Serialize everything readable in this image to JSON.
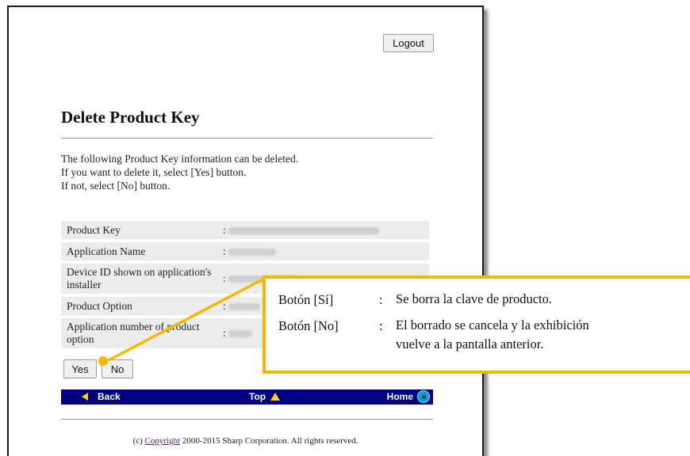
{
  "header": {
    "logout_label": "Logout"
  },
  "page": {
    "title": "Delete Product Key",
    "intro_lines": [
      "The following Product Key information can be deleted.",
      "If you want to delete it, select [Yes] button.",
      "If not, select [No] button."
    ]
  },
  "info_table": {
    "rows": [
      {
        "label": "Product Key",
        "value_sep": ":"
      },
      {
        "label": "Application Name",
        "value_sep": ":"
      },
      {
        "label": "Device ID shown on application's installer",
        "value_sep": ":"
      },
      {
        "label": "Product Option",
        "value_sep": ":"
      },
      {
        "label": "Application number of product option",
        "value_sep": ":"
      }
    ]
  },
  "actions": {
    "yes_label": "Yes",
    "no_label": "No"
  },
  "nav": {
    "back_label": "Back",
    "top_label": "Top",
    "home_label": "Home"
  },
  "footer": {
    "prefix": "(c) ",
    "link_text": "Copyright",
    "suffix": " 2000-2015 Sharp Corporation. All rights reserved."
  },
  "callout": {
    "yes_label": "Botón [Sí]",
    "yes_desc": "Se borra la clave de producto.",
    "no_label": "Botón [No]",
    "no_desc_line1": "El borrado se cancela y la exhibición",
    "no_desc_line2": "vuelve a la pantalla anterior.",
    "separator": ":"
  },
  "colors": {
    "navbar": "#000080",
    "callout_border": "#f5b800",
    "nav_arrow": "#ffd800"
  }
}
